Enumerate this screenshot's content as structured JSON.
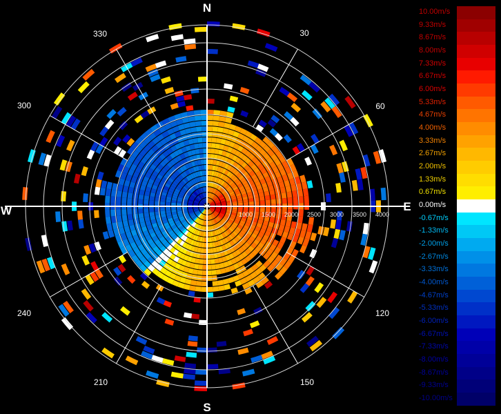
{
  "chart_data": {
    "type": "polar-ppi",
    "title": "",
    "compass": {
      "N": "N",
      "E": "E",
      "S": "S",
      "W": "W"
    },
    "bearing_labels": [
      "30",
      "60",
      "120",
      "150",
      "210",
      "240",
      "300",
      "330"
    ],
    "range_labels": [
      "1000",
      "1500",
      "2000",
      "2500",
      "3000",
      "3500",
      "4000"
    ],
    "range_max": 4300,
    "colorbar": {
      "unit": "m/s",
      "labels": [
        "10.00m/s",
        "9.33m/s",
        "8.67m/s",
        "8.00m/s",
        "7.33m/s",
        "6.67m/s",
        "6.00m/s",
        "5.33m/s",
        "4.67m/s",
        "4.00m/s",
        "3.33m/s",
        "2.67m/s",
        "2.00m/s",
        "1.33m/s",
        "0.67m/s",
        "0.00m/s",
        "-0.67m/s",
        "-1.33m/s",
        "-2.00m/s",
        "-2.67m/s",
        "-3.33m/s",
        "-4.00m/s",
        "-4.67m/s",
        "-5.33m/s",
        "-6.00m/s",
        "-6.67m/s",
        "-7.33m/s",
        "-8.00m/s",
        "-8.67m/s",
        "-9.33m/s",
        "-10.00m/s"
      ],
      "colors": [
        "#8b0000",
        "#a00000",
        "#b80000",
        "#d00000",
        "#e80000",
        "#ff1a00",
        "#ff3a00",
        "#ff5a00",
        "#ff7400",
        "#ff8c00",
        "#ffa200",
        "#ffb800",
        "#ffcc00",
        "#ffdd00",
        "#ffee00",
        "#ffffff",
        "#00e5ff",
        "#00c8f5",
        "#00aaf0",
        "#0090e8",
        "#0078e0",
        "#0060d8",
        "#0048d0",
        "#0030c8",
        "#0018c0",
        "#0000b8",
        "#0000a8",
        "#000098",
        "#000088",
        "#000078",
        "#000068"
      ],
      "text_colors": [
        "#c00000",
        "#c00000",
        "#c00000",
        "#c00000",
        "#d00000",
        "#d00000",
        "#d80000",
        "#e02000",
        "#e84000",
        "#f06000",
        "#f08000",
        "#f0a000",
        "#f0c000",
        "#f0d000",
        "#f0e000",
        "#ffffff",
        "#00d0ff",
        "#00b8f0",
        "#00a0e8",
        "#0088e0",
        "#0070d8",
        "#0058d0",
        "#0040c8",
        "#0030c0",
        "#0020b8",
        "#0010b0",
        "#0008a8",
        "#0000a0",
        "#000098",
        "#000090",
        "#000088"
      ]
    }
  }
}
